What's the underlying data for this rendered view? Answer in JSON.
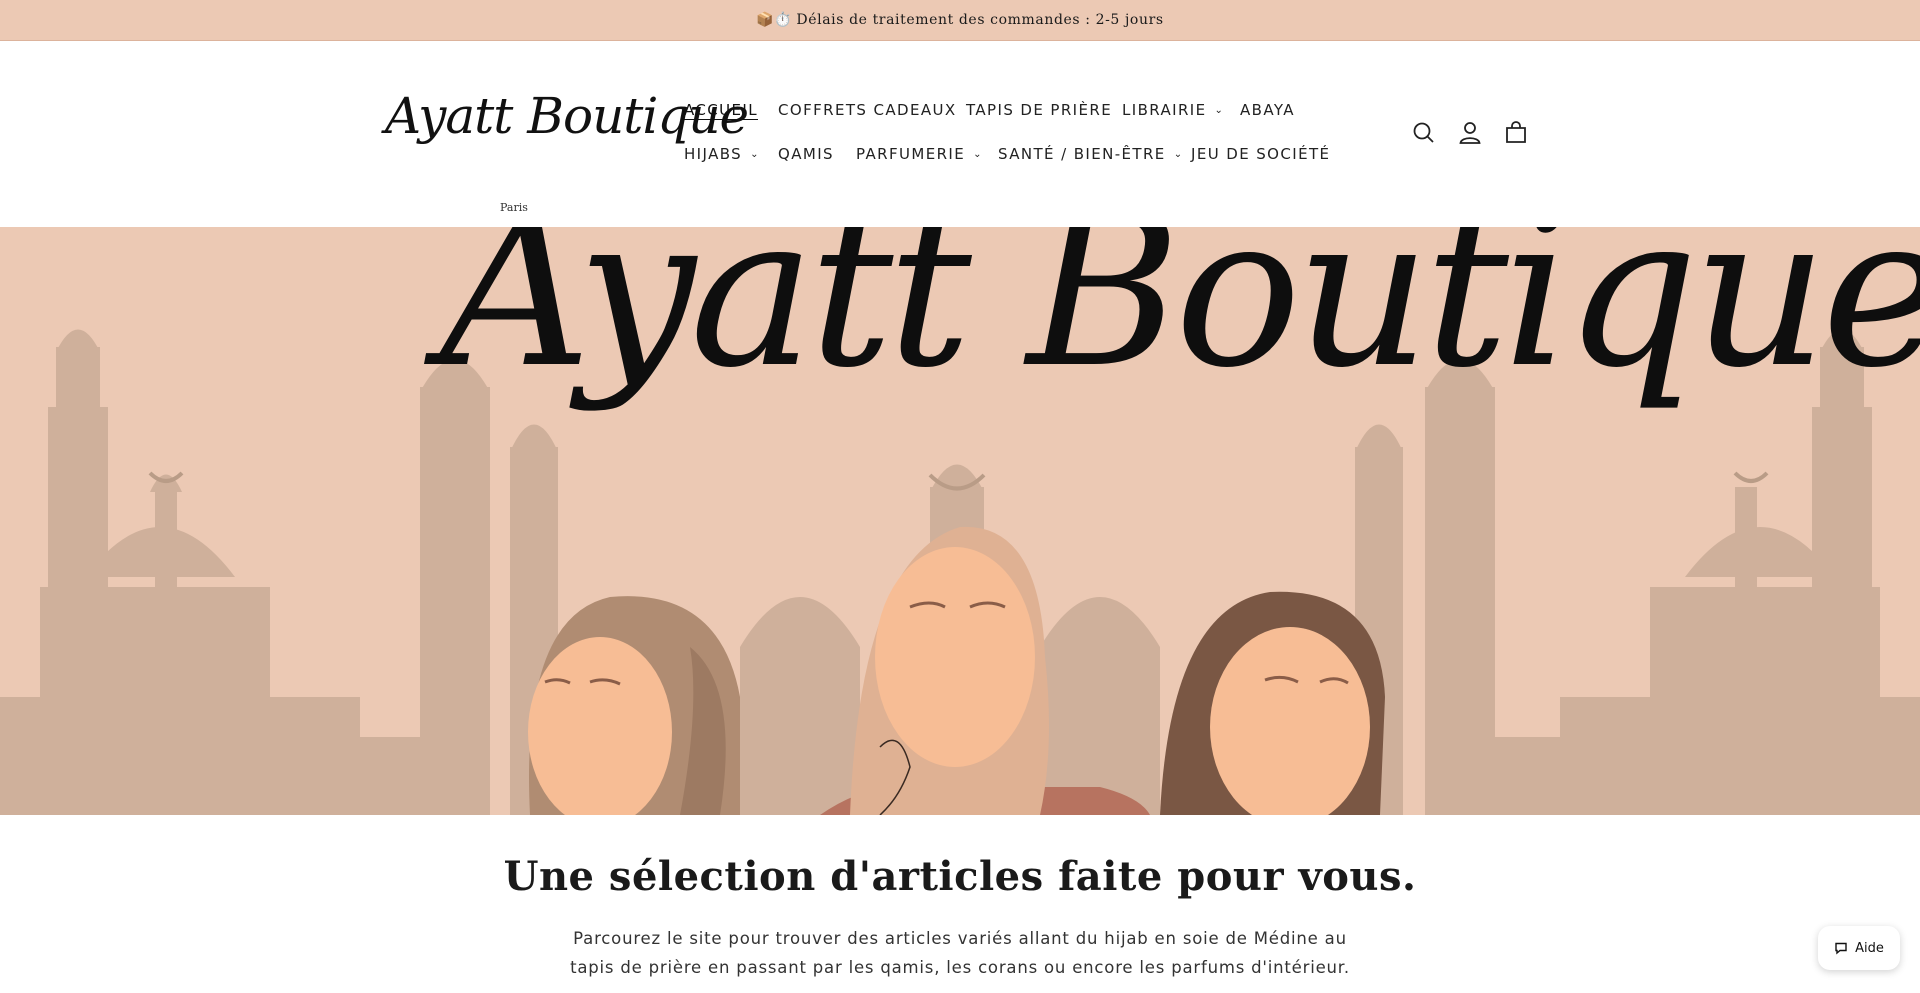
{
  "announcement": {
    "emoji": "📦⏱️",
    "text": "Délais de traitement des commandes : 2-5 jours"
  },
  "header": {
    "logo": {
      "name": "Ayatt Boutique",
      "sub": "Paris"
    },
    "nav_row1": [
      {
        "label": "ACCUEIL",
        "active": true,
        "dropdown": false
      },
      {
        "label": "COFFRETS CADEAUX",
        "active": false,
        "dropdown": false
      },
      {
        "label": "TAPIS DE PRIÈRE",
        "active": false,
        "dropdown": false
      },
      {
        "label": "LIBRAIRIE",
        "active": false,
        "dropdown": true
      },
      {
        "label": "ABAYA",
        "active": false,
        "dropdown": false
      }
    ],
    "nav_row2": [
      {
        "label": "HIJABS",
        "active": false,
        "dropdown": true
      },
      {
        "label": "QAMIS",
        "active": false,
        "dropdown": false
      },
      {
        "label": "PARFUMERIE",
        "active": false,
        "dropdown": true
      },
      {
        "label": "SANTÉ / BIEN-ÊTRE",
        "active": false,
        "dropdown": true
      },
      {
        "label": "JEU DE SOCIÉTÉ",
        "active": false,
        "dropdown": false
      }
    ],
    "icons": [
      "search-icon",
      "account-icon",
      "cart-icon"
    ]
  },
  "hero": {
    "title": "Ayatt Boutique",
    "colors": {
      "background": "#ecc9b4",
      "silhouette": "#cfb09b",
      "skin": "#f7bd95"
    }
  },
  "intro": {
    "heading": "Une sélection d'articles faite pour vous.",
    "text": "Parcourez le site pour trouver des articles variés allant du hijab en soie de Médine au tapis de prière en passant par les qamis, les corans ou encore les parfums d'intérieur."
  },
  "help": {
    "label": "Aide"
  }
}
